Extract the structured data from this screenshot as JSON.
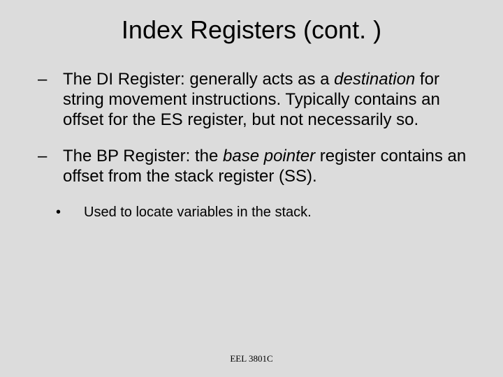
{
  "slide": {
    "title": "Index Registers (cont. )",
    "bullets": [
      {
        "dash": "–",
        "prefix": "The DI Register: generally acts as a ",
        "em": "destination",
        "suffix": " for string movement instructions.  Typically contains an offset for the ES register, but not necessarily so."
      },
      {
        "dash": "–",
        "prefix": "The BP Register: the ",
        "em": "base pointer",
        "suffix": " register contains an offset from the stack register (SS)."
      }
    ],
    "subbullet": {
      "dot": "•",
      "text": "Used to locate variables in the stack."
    },
    "footer": "EEL 3801C"
  }
}
